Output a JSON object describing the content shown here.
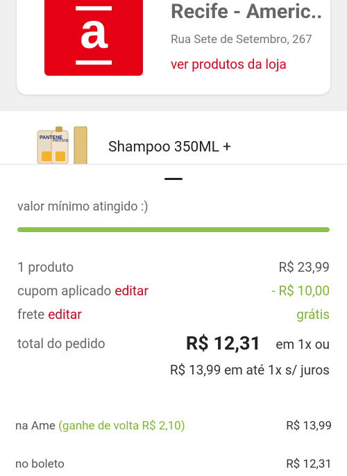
{
  "store": {
    "logo_letter": "a",
    "name": "Recife - Americ..",
    "address": "Rua Sete de Setembro, 267",
    "link": "ver produtos da loja"
  },
  "product": {
    "brand_text": "PANTENE",
    "name": "Shampoo 350ML +"
  },
  "summary": {
    "min_label": "valor mínimo atingido :)",
    "progress": 1.0,
    "items_label": "1 produto",
    "items_value": "R$ 23,99",
    "coupon_label": "cupom aplicado",
    "coupon_edit": "editar",
    "coupon_value": "- R$ 10,00",
    "shipping_label": "frete",
    "shipping_edit": "editar",
    "shipping_value": "grátis",
    "total_label": "total do pedido",
    "total_amount": "R$ 12,31",
    "total_suffix": "em 1x ou",
    "installment": "R$ 13,99 em até 1x s/ juros"
  },
  "payments": [
    {
      "label": "na Ame",
      "bonus": "(ganhe de volta R$ 2,10)",
      "value": "R$ 13,99"
    },
    {
      "label": "no boleto",
      "bonus": "",
      "value": "R$ 12,31"
    }
  ],
  "colors": {
    "brand_red": "#e60014",
    "accent_green": "#7cb82f",
    "progress_green": "#8cc04b",
    "edit_red": "#d3001b"
  }
}
